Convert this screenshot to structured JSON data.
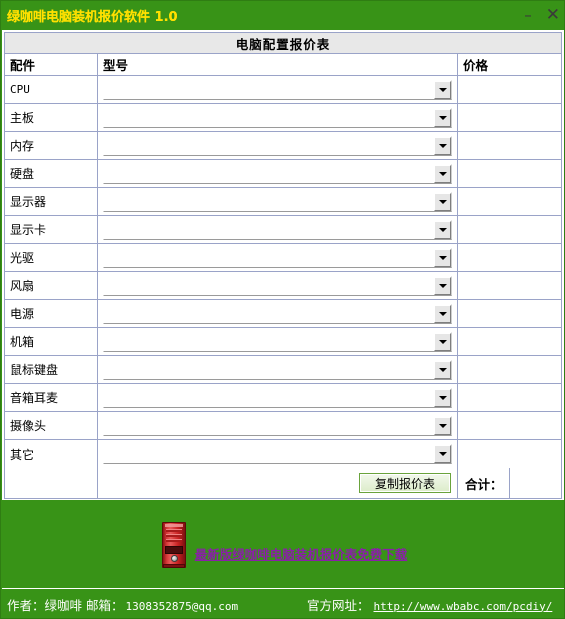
{
  "window": {
    "title": "绿咖啡电脑装机报价软件 1.0",
    "titlebar_bg": "#389317",
    "title_color": "#ffe000",
    "minimize_label": "–",
    "close_label": "✕"
  },
  "panel": {
    "caption": "电脑配置报价表"
  },
  "table": {
    "columns": [
      "配件",
      "型号",
      "价格"
    ],
    "rows": [
      {
        "part": "CPU",
        "latin": true,
        "model": "",
        "price": ""
      },
      {
        "part": "主板",
        "latin": false,
        "model": "",
        "price": ""
      },
      {
        "part": "内存",
        "latin": false,
        "model": "",
        "price": ""
      },
      {
        "part": "硬盘",
        "latin": false,
        "model": "",
        "price": ""
      },
      {
        "part": "显示器",
        "latin": false,
        "model": "",
        "price": ""
      },
      {
        "part": "显示卡",
        "latin": false,
        "model": "",
        "price": ""
      },
      {
        "part": "光驱",
        "latin": false,
        "model": "",
        "price": ""
      },
      {
        "part": "风扇",
        "latin": false,
        "model": "",
        "price": ""
      },
      {
        "part": "电源",
        "latin": false,
        "model": "",
        "price": ""
      },
      {
        "part": "机箱",
        "latin": false,
        "model": "",
        "price": ""
      },
      {
        "part": "鼠标键盘",
        "latin": false,
        "model": "",
        "price": ""
      },
      {
        "part": "音箱耳麦",
        "latin": false,
        "model": "",
        "price": ""
      },
      {
        "part": "摄像头",
        "latin": false,
        "model": "",
        "price": ""
      },
      {
        "part": "其它",
        "latin": false,
        "model": "",
        "price": ""
      }
    ],
    "combo_placeholder": ""
  },
  "footer_row": {
    "copy_button": "复制报价表",
    "total_label": "合计：",
    "total_value": ""
  },
  "promo": {
    "icon": "pc-tower-icon",
    "link_text": "最新版绿咖啡电脑装机报价表免费下载",
    "link_color": "#8a1fa8"
  },
  "statusbar": {
    "author_label": "作者：绿咖啡 邮箱：",
    "author_email": "1308352875@qq.com",
    "site_label": "官方网址：",
    "site_url": "http://www.wbabc.com/pcdiy/"
  }
}
